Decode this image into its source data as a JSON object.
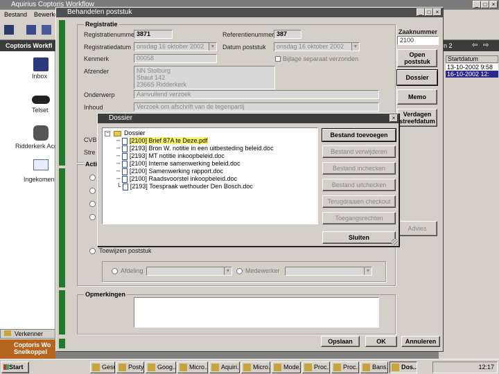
{
  "main_window": {
    "title": "Aquirius   Coptoris Workflow",
    "menu": [
      "Bestand",
      "Bewerken"
    ]
  },
  "left_nav": {
    "title": "Coptoris Workfl",
    "items": [
      {
        "label": "Inbox",
        "icon": "inbox-icon"
      },
      {
        "label": "Telset",
        "icon": "telephone-icon"
      },
      {
        "label": "Ridderkerk Acc",
        "icon": "database-icon"
      },
      {
        "label": "Ingekomen p",
        "icon": "envelope-icon"
      }
    ],
    "verkenner": "Verkenner",
    "shortcut_title": "Coptoris Wo",
    "shortcut_sub": "Snelkoppel"
  },
  "right_panel": {
    "tab": "en 2",
    "header": "Startdatum",
    "rows": [
      "13-10-2002 9:58",
      "16-10-2002 12:"
    ]
  },
  "dialog": {
    "title": "Behandelen poststuk",
    "group_registratie": "Registratie",
    "registratienummer_label": "Registratienummer",
    "registratienummer_value": "3871",
    "referentienummer_label": "Referentienummer",
    "referentienummer_value": "387",
    "registratiedatum_label": "Registratiedatum",
    "registratiedatum_value": "onsdag   16   oktober  2002",
    "datum_poststuk_label": "Datum poststuk",
    "datum_poststuk_value": "onsdag   16   oktober  2002",
    "kenmerk_label": "Kenmerk",
    "kenmerk_value": "00058",
    "bijlage_label": "Bijlage separaat verzonden",
    "afzender_label": "Afzender",
    "afzender_lines": [
      "NN Stolburg",
      "Sbaut 142",
      "2366S   Ridderkerk"
    ],
    "onderwerp_label": "Onderwerp",
    "onderwerp_value": "Aanvullend verzoek",
    "inhoud_label": "Inhoud",
    "inhoud_value": "Verzoek om afschrift van de tegenpartij",
    "cvb_label": "CVB",
    "stre_label": "Stre",
    "actions_group_title": "Acti",
    "toewijzen_label": "Toewijzen poststuk",
    "afdeling_label": "Afdeling",
    "medewerker_label": "Medewerker",
    "opmerkingen_title": "Opmerkingen",
    "zaaknummer_label": "Zaaknummer",
    "zaaknummer_value": "2100",
    "btn_open": "Open poststuk",
    "btn_dossier": "Dossier",
    "btn_memo": "Memo",
    "btn_verdagen": "Verdagen streefdatum",
    "btn_advies": "Advies",
    "btn_opslaan": "Opslaan",
    "btn_ok": "OK",
    "btn_annuleren": "Annuleren"
  },
  "dossier": {
    "title": "Dossier",
    "root": "Dossier",
    "files": [
      "[2100] Brief 87A te Deze.pdf",
      "[2193] Bron W. notitie in een uitbesteding beleid.doc",
      "[2193] MT notitie inkoopbeleid.doc",
      "[2100] Interne samenwerking beleid.doc",
      "[2100] Samenwerking rapport.doc",
      "[2100] Raadsvoorstel inkoopbeleid.doc",
      "[2193] Toespraak wethouder Den Bosch.doc"
    ],
    "buttons": {
      "add": "Bestand toevoegen",
      "remove": "Bestand verwijderen",
      "checkin": "Bestand inchecken",
      "checkout": "Bestand uitchecken",
      "undo_checkout": "Terugdraaien checkout",
      "permissions": "Toegangsrechten",
      "close": "Sluiten"
    }
  },
  "taskbar": {
    "start": "Start",
    "tasks": [
      "Gesu...",
      "Posty...",
      "Goog...",
      "Micro...",
      "Aquiri...",
      "Micro...",
      "Mode...",
      "Proc...",
      "Proc...",
      "Bans...",
      "Dos..."
    ],
    "clock": "12:17"
  },
  "colors": {
    "accent_green": "#1f7a2c",
    "title_dark": "#4f4f4f",
    "face": "#d4d0c8"
  }
}
